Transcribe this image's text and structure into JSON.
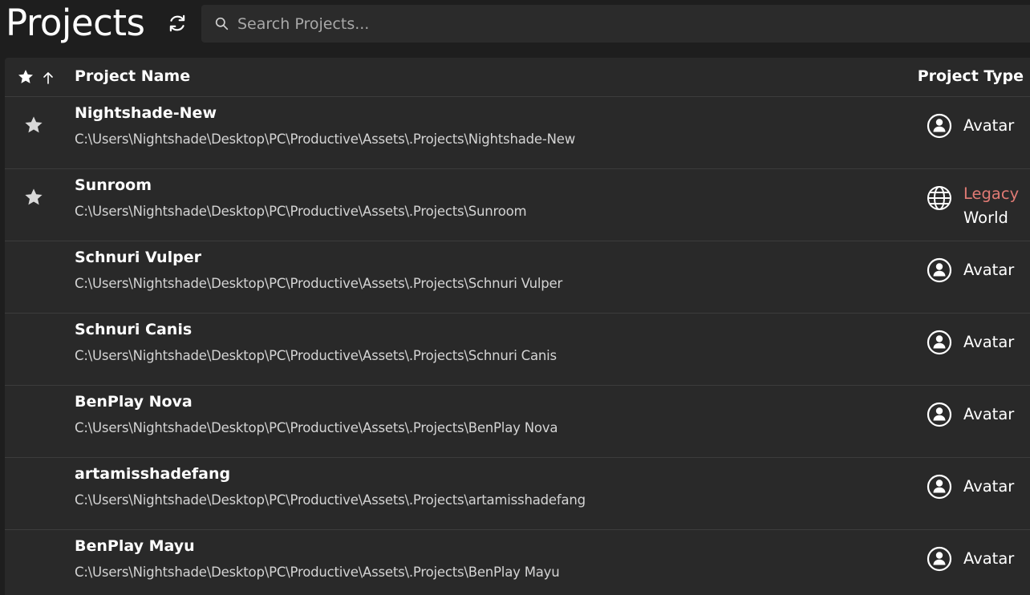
{
  "header": {
    "title": "Projects",
    "refresh_icon": "refresh-icon",
    "search": {
      "placeholder": "Search Projects...",
      "value": "",
      "icon": "search-icon"
    }
  },
  "table": {
    "columns": {
      "favorite_icon": "star-icon",
      "sort_icon": "arrow-up-icon",
      "name": "Project Name",
      "type": "Project Type"
    },
    "rows": [
      {
        "name": "Nightshade-New",
        "path": "C:\\Users\\Nightshade\\Desktop\\PC\\Productive\\Assets\\.Projects\\Nightshade-New",
        "favorite": true,
        "type": "Avatar",
        "type_icon": "avatar-icon",
        "legacy": ""
      },
      {
        "name": "Sunroom",
        "path": "C:\\Users\\Nightshade\\Desktop\\PC\\Productive\\Assets\\.Projects\\Sunroom",
        "favorite": true,
        "type": "World",
        "type_icon": "globe-icon",
        "legacy": "Legacy"
      },
      {
        "name": "Schnuri Vulper",
        "path": "C:\\Users\\Nightshade\\Desktop\\PC\\Productive\\Assets\\.Projects\\Schnuri Vulper",
        "favorite": false,
        "type": "Avatar",
        "type_icon": "avatar-icon",
        "legacy": ""
      },
      {
        "name": "Schnuri Canis",
        "path": "C:\\Users\\Nightshade\\Desktop\\PC\\Productive\\Assets\\.Projects\\Schnuri Canis",
        "favorite": false,
        "type": "Avatar",
        "type_icon": "avatar-icon",
        "legacy": ""
      },
      {
        "name": "BenPlay Nova",
        "path": "C:\\Users\\Nightshade\\Desktop\\PC\\Productive\\Assets\\.Projects\\BenPlay Nova",
        "favorite": false,
        "type": "Avatar",
        "type_icon": "avatar-icon",
        "legacy": ""
      },
      {
        "name": "artamisshadefang",
        "path": "C:\\Users\\Nightshade\\Desktop\\PC\\Productive\\Assets\\.Projects\\artamisshadefang",
        "favorite": false,
        "type": "Avatar",
        "type_icon": "avatar-icon",
        "legacy": ""
      },
      {
        "name": "BenPlay Mayu",
        "path": "C:\\Users\\Nightshade\\Desktop\\PC\\Productive\\Assets\\.Projects\\BenPlay Mayu",
        "favorite": false,
        "type": "Avatar",
        "type_icon": "avatar-icon",
        "legacy": ""
      }
    ]
  },
  "colors": {
    "background": "#1e1e1e",
    "panel": "#292929",
    "search_bg": "#2b2b2b",
    "legacy_text": "#e07a74",
    "path_text": "#d4d4d4",
    "divider": "#3c3c3c"
  }
}
